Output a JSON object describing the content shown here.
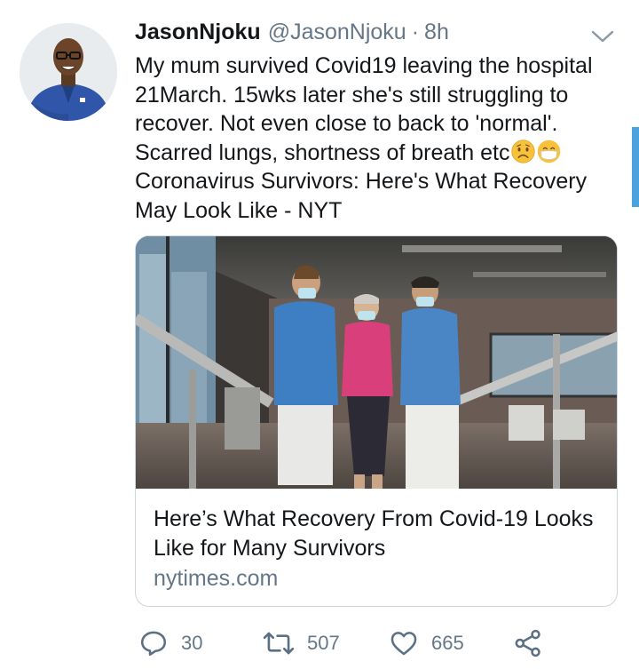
{
  "tweet": {
    "author": {
      "display_name": "JasonNjoku",
      "handle": "@JasonNjoku",
      "separator": "·",
      "time": "8h",
      "avatar_icon": "profile-photo"
    },
    "text_lines": [
      "My mum survived Covid19 leaving the hospital",
      "21March. 15wks later she's still struggling to",
      "recover. Not even close to back to 'normal'.",
      "Scarred lungs, shortness of breath etc",
      "Coronavirus Survivors: Here's What Recovery",
      "May Look Like - NYT"
    ],
    "emojis": [
      "worried-face",
      "face-with-medical-mask"
    ]
  },
  "link_card": {
    "image_icon": "rehabilitation-photo",
    "title_lines": [
      "Here’s What Recovery From Covid-19 Looks",
      "Like for Many Survivors"
    ],
    "domain": "nytimes.com"
  },
  "actions": {
    "reply": {
      "count": "30",
      "icon": "reply-icon"
    },
    "retweet": {
      "count": "507",
      "icon": "retweet-icon"
    },
    "like": {
      "count": "665",
      "icon": "heart-icon"
    },
    "share": {
      "icon": "share-icon"
    }
  },
  "colors": {
    "text": "#14171a",
    "secondary": "#657786",
    "border": "#ccd6dd",
    "icon": "#5b7083",
    "scroll_indicator": "#4aa3df"
  }
}
